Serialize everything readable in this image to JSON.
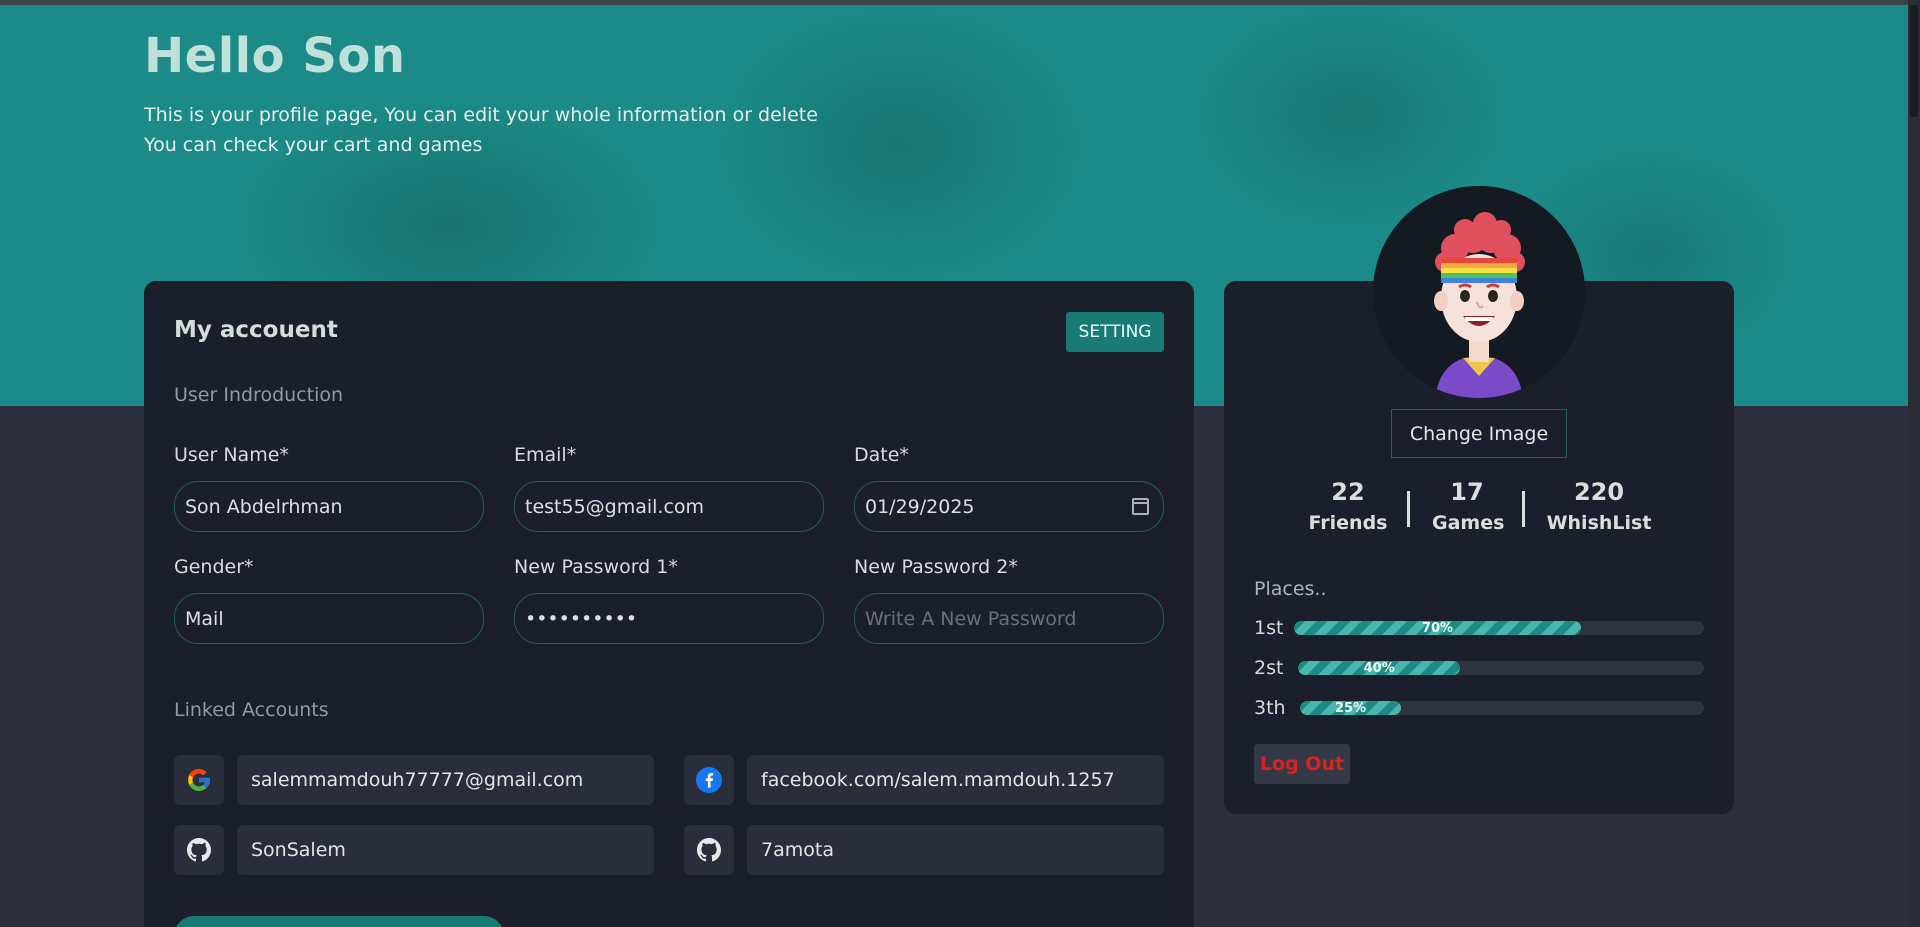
{
  "header": {
    "title": "Hello Son",
    "line1": "This is your profile page, You can edit your whole information or delete",
    "line2": "You can check your cart and games"
  },
  "account": {
    "title": "My accouent",
    "setting_label": "SETTING",
    "intro_label": "User Indroduction",
    "fields": {
      "username": {
        "label": "User Name*",
        "value": "Son Abdelrhman"
      },
      "email": {
        "label": "Email*",
        "value": "test55@gmail.com"
      },
      "date": {
        "label": "Date*",
        "value": "01/29/2025"
      },
      "gender": {
        "label": "Gender*",
        "value": "Mail"
      },
      "password1": {
        "label": "New Password 1*",
        "value": "••••••••••"
      },
      "password2": {
        "label": "New Password 2*",
        "placeholder": "Write A New Password"
      }
    },
    "linked_label": "Linked Accounts",
    "linked": {
      "google": "salemmamdouh77777@gmail.com",
      "facebook": "facebook.com/salem.mamdouh.1257",
      "github1": "SonSalem",
      "github2": "7amota"
    }
  },
  "profile": {
    "change_image": "Change Image",
    "stats": {
      "friends": {
        "value": "22",
        "label": "Friends"
      },
      "games": {
        "value": "17",
        "label": "Games"
      },
      "wishlist": {
        "value": "220",
        "label": "WhishList"
      }
    },
    "places_label": "Places..",
    "places": [
      {
        "label": "1st",
        "percent_text": "70%",
        "percent": 70
      },
      {
        "label": "2st",
        "percent_text": "40%",
        "percent": 40
      },
      {
        "label": "3th",
        "percent_text": "25%",
        "percent": 25
      }
    ],
    "logout": "Log Out"
  },
  "colors": {
    "accent": "#1a7a76",
    "hero": "#1c8a86",
    "card": "#1b1e2b",
    "danger": "#e0201e"
  }
}
